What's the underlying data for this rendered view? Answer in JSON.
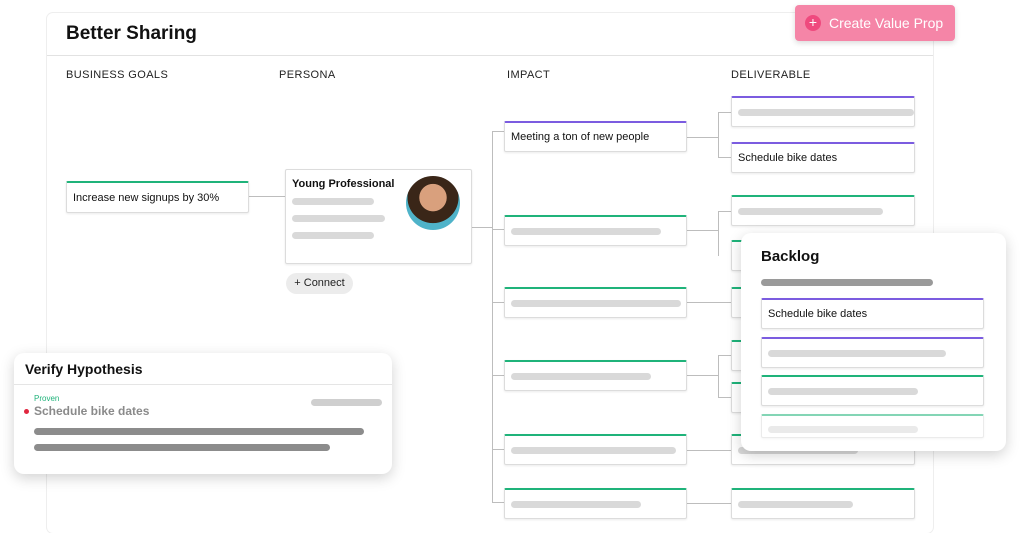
{
  "app": {
    "title": "Better Sharing"
  },
  "create_button": {
    "label": "Create Value Prop",
    "icon": "plus-icon"
  },
  "columns": [
    "BUSINESS GOALS",
    "PERSONA",
    "IMPACT",
    "DELIVERABLE"
  ],
  "business_goal": {
    "text": "Increase new signups by 30%"
  },
  "persona": {
    "name": "Young Professional",
    "avatar_icon": "person-avatar"
  },
  "connect_button": {
    "label": "+ Connect"
  },
  "impacts": [
    {
      "text": "Meeting a ton of new people"
    }
  ],
  "deliverables": [
    {
      "text": "Schedule bike dates"
    }
  ],
  "verify_panel": {
    "title": "Verify Hypothesis",
    "status": "Proven",
    "item": "Schedule bike dates"
  },
  "backlog_panel": {
    "title": "Backlog",
    "item": "Schedule bike dates"
  },
  "colors": {
    "green": "#1fb37a",
    "purple": "#7b5ce0",
    "pink": "#f585a7",
    "red": "#e0263f"
  }
}
